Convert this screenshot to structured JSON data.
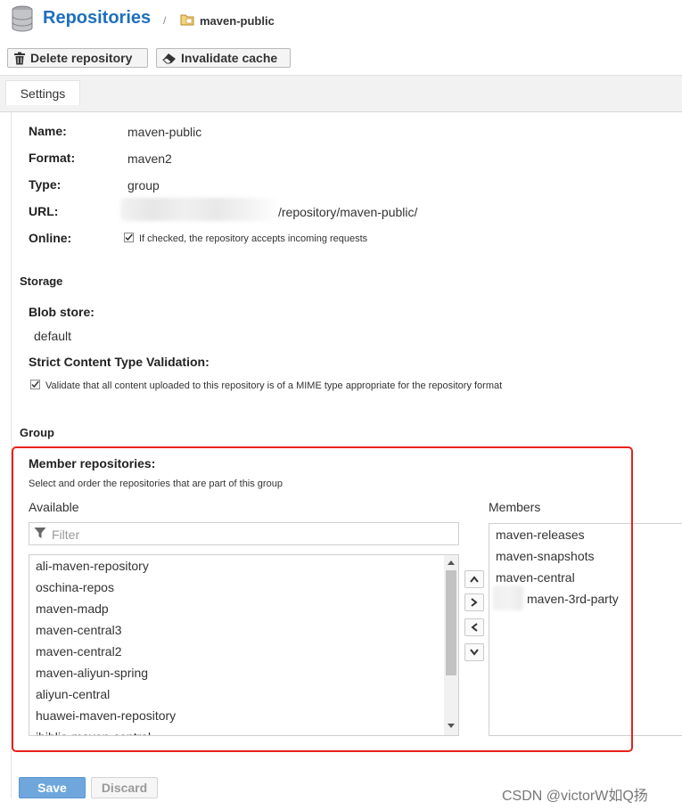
{
  "header": {
    "title": "Repositories",
    "separator": "/",
    "breadcrumb": "maven-public"
  },
  "toolbar": {
    "delete_label": "Delete repository",
    "invalidate_label": "Invalidate cache"
  },
  "tabs": {
    "settings": "Settings"
  },
  "settings": {
    "name_label": "Name:",
    "name_value": "maven-public",
    "format_label": "Format:",
    "format_value": "maven2",
    "type_label": "Type:",
    "type_value": "group",
    "url_label": "URL:",
    "url_value": "/repository/maven-public/",
    "online_label": "Online:",
    "online_checked": true,
    "online_hint": "If checked, the repository accepts incoming requests"
  },
  "storage": {
    "section": "Storage",
    "blob_label": "Blob store:",
    "blob_value": "default",
    "strict_label": "Strict Content Type Validation:",
    "strict_checked": true,
    "strict_hint": "Validate that all content uploaded to this repository is of a MIME type appropriate for the repository format"
  },
  "group": {
    "section": "Group",
    "member_label": "Member repositories:",
    "member_hint": "Select and order the repositories that are part of this group",
    "available_label": "Available",
    "members_label": "Members",
    "filter_placeholder": "Filter",
    "available": [
      "ali-maven-repository",
      "oschina-repos",
      "maven-madp",
      "maven-central3",
      "maven-central2",
      "maven-aliyun-spring",
      "aliyun-central",
      "huawei-maven-repository",
      "ibiblio-maven-central"
    ],
    "members": [
      "maven-releases",
      "maven-snapshots",
      "maven-central",
      "maven-3rd-party"
    ]
  },
  "footer": {
    "save_label": "Save",
    "discard_label": "Discard",
    "watermark": "CSDN @victorW如Q扬"
  },
  "colors": {
    "title": "#1e6fbf",
    "highlight_border": "#e8201a",
    "save_button": "#6fa7dd"
  }
}
